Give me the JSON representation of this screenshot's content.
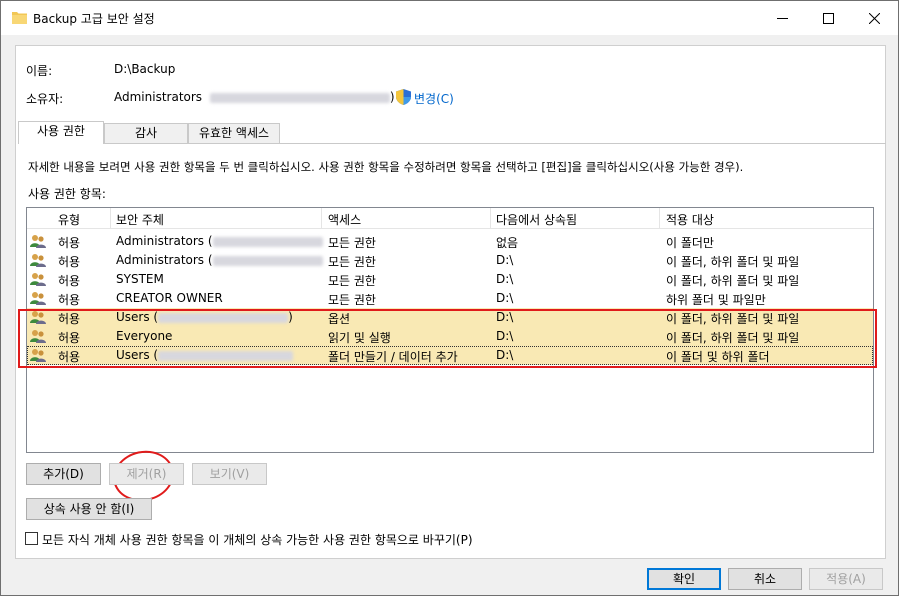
{
  "window": {
    "title": "Backup 고급 보안 설정"
  },
  "info": {
    "name_label": "이름:",
    "name_value": "D:\\Backup",
    "owner_label": "소유자:",
    "owner_value": "Administrators",
    "owner_close_paren": ")",
    "change_link": "변경(C)"
  },
  "tabs": [
    {
      "label": "사용 권한",
      "active": true
    },
    {
      "label": "감사",
      "active": false
    },
    {
      "label": "유효한 액세스",
      "active": false
    }
  ],
  "instruction": "자세한 내용을 보려면 사용 권한 항목을 두 번 클릭하십시오. 사용 권한 항목을 수정하려면 항목을 선택하고 [편집]을 클릭하십시오(사용 가능한 경우).",
  "entries_label": "사용 권한 항목:",
  "columns": [
    "유형",
    "보안 주체",
    "액세스",
    "다음에서 상속됨",
    "적용 대상"
  ],
  "rows": [
    {
      "type": "허용",
      "principal": "Administrators (",
      "access": "모든 권한",
      "inherited": "없음",
      "applies": "이 폴더만",
      "selected": false
    },
    {
      "type": "허용",
      "principal": "Administrators (",
      "access": "모든 권한",
      "inherited": "D:\\",
      "applies": "이 폴더, 하위 폴더 및 파일",
      "selected": false
    },
    {
      "type": "허용",
      "principal": "SYSTEM",
      "access": "모든 권한",
      "inherited": "D:\\",
      "applies": "이 폴더, 하위 폴더 및 파일",
      "selected": false
    },
    {
      "type": "허용",
      "principal": "CREATOR OWNER",
      "access": "모든 권한",
      "inherited": "D:\\",
      "applies": "하위 폴더 및 파일만",
      "selected": false
    },
    {
      "type": "허용",
      "principal": "Users (",
      "access": "옵션",
      "inherited": "D:\\",
      "applies": "이 폴더, 하위 폴더 및 파일",
      "selected": true
    },
    {
      "type": "허용",
      "principal": "Everyone",
      "access": "읽기 및 실행",
      "inherited": "D:\\",
      "applies": "이 폴더, 하위 폴더 및 파일",
      "selected": true
    },
    {
      "type": "허용",
      "principal": "Users (",
      "access": "폴더 만들기 / 데이터 추가",
      "inherited": "D:\\",
      "applies": "이 폴더 및 하위 폴더",
      "selected": true
    }
  ],
  "buttons": {
    "add": "추가(D)",
    "remove": "제거(R)",
    "view": "보기(V)",
    "disable_inheritance": "상속 사용 안 함(I)",
    "ok": "확인",
    "cancel": "취소",
    "apply": "적용(A)"
  },
  "replace_checkbox_label": "모든 자식 개체 사용 권한 항목을 이 개체의 상속 가능한 사용 권한 항목으로 바꾸기(P)",
  "replace_checked": false
}
